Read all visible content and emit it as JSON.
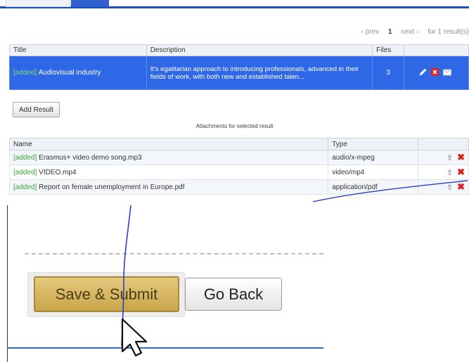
{
  "pager": {
    "prev": "‹ prev",
    "current": "1",
    "next": "next ›",
    "summary": "for 1 result(s)"
  },
  "results_table": {
    "headers": [
      "Title",
      "Description",
      "Files",
      ""
    ],
    "row": {
      "tag": "[added]",
      "title": "Audiovisual industry",
      "description": "It's egalitarian approach to introducing professionals, advanced in their fields of work, with both new and established talen...",
      "files": "3"
    }
  },
  "add_result_label": "Add Result",
  "attachments_caption": "Attachments for selected result",
  "attachments_table": {
    "headers": [
      "Name",
      "Type",
      ""
    ],
    "rows": [
      {
        "tag": "[added]",
        "name": "Erasmus+ video demo song.mp3",
        "type": "audio/x-mpeg"
      },
      {
        "tag": "[added]",
        "name": "VIDEO.mp4",
        "type": "video/mp4"
      },
      {
        "tag": "[added]",
        "name": "Report on female unemployment in Europe.pdf",
        "type": "application/pdf"
      }
    ]
  },
  "actions": {
    "save_submit": "Save & Submit",
    "go_back": "Go Back"
  },
  "colors": {
    "selection": "#2f68e6",
    "accent_bar": "#1e4fb8",
    "added_tag": "#3aa83a",
    "delete_red": "#e21b1b",
    "save_button": "#d7b862"
  },
  "icons": [
    "pencil-icon",
    "delete-icon",
    "envelope-icon",
    "upload-icon",
    "mouse-cursor-icon"
  ]
}
